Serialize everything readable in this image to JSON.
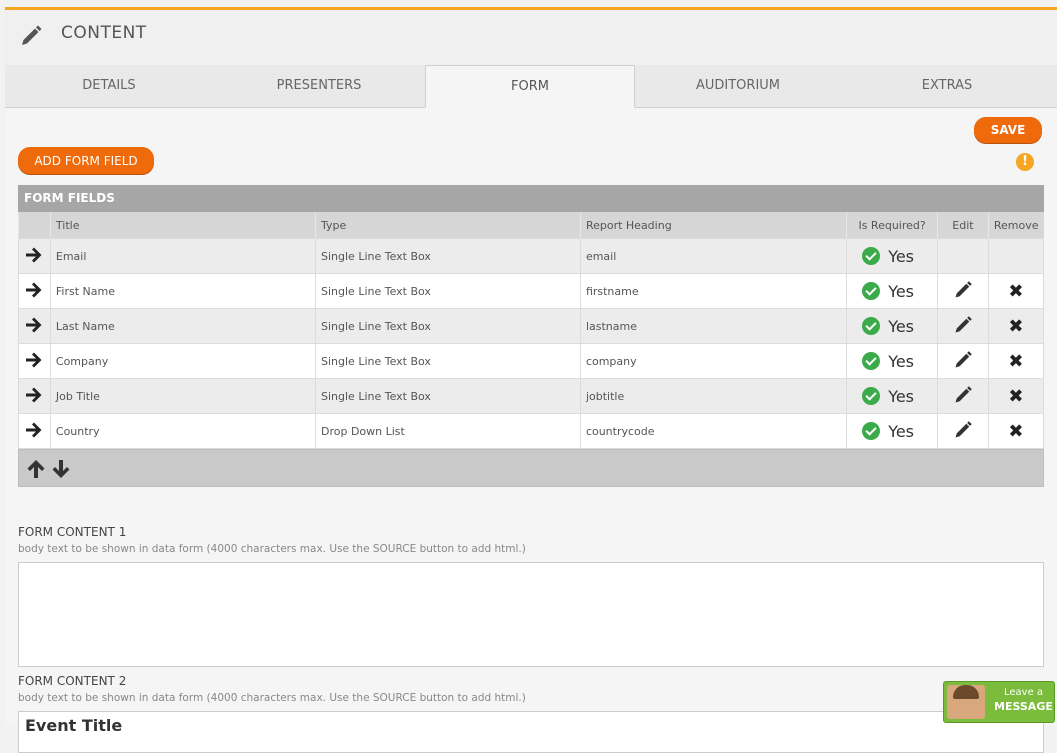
{
  "header": {
    "title": "CONTENT",
    "icon": "pencil-icon"
  },
  "tabs": [
    {
      "label": "DETAILS"
    },
    {
      "label": "PRESENTERS"
    },
    {
      "label": "FORM"
    },
    {
      "label": "AUDITORIUM"
    },
    {
      "label": "EXTRAS"
    }
  ],
  "active_tab": "FORM",
  "colors": {
    "accent": "#ee6a0b",
    "topbar": "#f5a623",
    "check": "#3aaa4a"
  },
  "actions": {
    "save_label": "SAVE",
    "add_field_label": "ADD FORM FIELD",
    "warning_symbol": "!"
  },
  "form_fields": {
    "title": "FORM FIELDS",
    "columns": {
      "title": "Title",
      "type": "Type",
      "report": "Report Heading",
      "required": "Is Required?",
      "edit": "Edit",
      "remove": "Remove"
    },
    "rows": [
      {
        "title": "Email",
        "type": "Single Line Text Box",
        "report": "email",
        "required": "Yes",
        "editable": false
      },
      {
        "title": "First Name",
        "type": "Single Line Text Box",
        "report": "firstname",
        "required": "Yes",
        "editable": true
      },
      {
        "title": "Last Name",
        "type": "Single Line Text Box",
        "report": "lastname",
        "required": "Yes",
        "editable": true
      },
      {
        "title": "Company",
        "type": "Single Line Text Box",
        "report": "company",
        "required": "Yes",
        "editable": true
      },
      {
        "title": "Job Title",
        "type": "Single Line Text Box",
        "report": "jobtitle",
        "required": "Yes",
        "editable": true
      },
      {
        "title": "Country",
        "type": "Drop Down List",
        "report": "countrycode",
        "required": "Yes",
        "editable": true
      }
    ]
  },
  "form_content_1": {
    "title": "FORM CONTENT 1",
    "help": "body text to be shown in data form (4000 characters max. Use the SOURCE button to add html.)"
  },
  "form_content_2": {
    "title": "FORM CONTENT 2",
    "help": "body text to be shown in data form (4000 characters max. Use the SOURCE button to add html.)",
    "value": "Event Title"
  },
  "chat_widget": {
    "line1": "Leave a",
    "line2": "MESSAGE"
  }
}
